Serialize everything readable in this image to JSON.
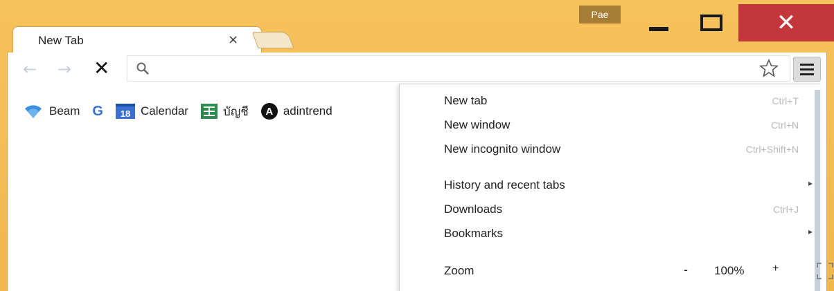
{
  "profile": {
    "name": "Pae"
  },
  "tab": {
    "title": "New Tab",
    "close": "×"
  },
  "window_controls": {
    "close": "✕"
  },
  "nav": {
    "back": "←",
    "forward": "→",
    "stop": "✕"
  },
  "bookmarks": [
    {
      "label": "Beam",
      "icon": "wifi-icon"
    },
    {
      "label": "",
      "icon": "google-icon",
      "glyph": "G"
    },
    {
      "label": "Calendar",
      "icon": "calendar-icon",
      "glyph": "18"
    },
    {
      "label": "บัญชี",
      "icon": "sheets-icon"
    },
    {
      "label": "adintrend",
      "icon": "adintrend-icon",
      "glyph": "A"
    }
  ],
  "menu": {
    "items": [
      {
        "label": "New tab",
        "shortcut": "Ctrl+T"
      },
      {
        "label": "New window",
        "shortcut": "Ctrl+N"
      },
      {
        "label": "New incognito window",
        "shortcut": "Ctrl+Shift+N"
      },
      {
        "label": "History and recent tabs",
        "arrow": "▸"
      },
      {
        "label": "Downloads",
        "shortcut": "Ctrl+J"
      },
      {
        "label": "Bookmarks",
        "arrow": "▸"
      }
    ],
    "zoom": {
      "label": "Zoom",
      "minus": "-",
      "value": "100%",
      "plus": "+"
    }
  },
  "colors": {
    "frame": "#f2b94f",
    "close": "#c3363b",
    "accent": "#3b6fd1"
  }
}
